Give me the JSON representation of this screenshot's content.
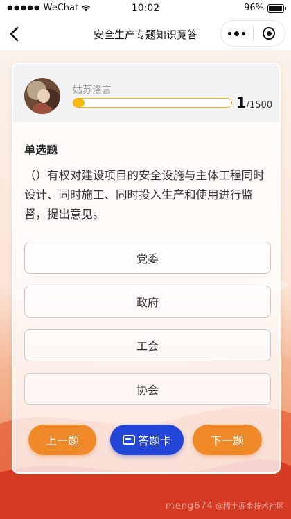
{
  "status_bar": {
    "carrier": "WeChat",
    "time": "10:02",
    "battery": "96%"
  },
  "nav": {
    "title": "安全生产专题知识竞答"
  },
  "profile": {
    "username": "姑苏洛言",
    "progress_current": "1",
    "progress_total": "/1500",
    "progress_fraction": 0.0007
  },
  "question": {
    "type": "单选题",
    "text": "（）有权对建设项目的安全设施与主体工程同时设计、同时施工、同时投入生产和使用进行监督，提出意见。",
    "options": [
      "党委",
      "政府",
      "工会",
      "协会"
    ]
  },
  "buttons": {
    "prev": "上一题",
    "answer_card": "答题卡",
    "next": "下一题"
  },
  "watermark": {
    "text1": "meng674",
    "text2": "@稀土掘金技术社区"
  },
  "colors": {
    "accent_orange": "#f08a28",
    "accent_blue": "#2346d8",
    "progress_yellow": "#f5b90f"
  }
}
